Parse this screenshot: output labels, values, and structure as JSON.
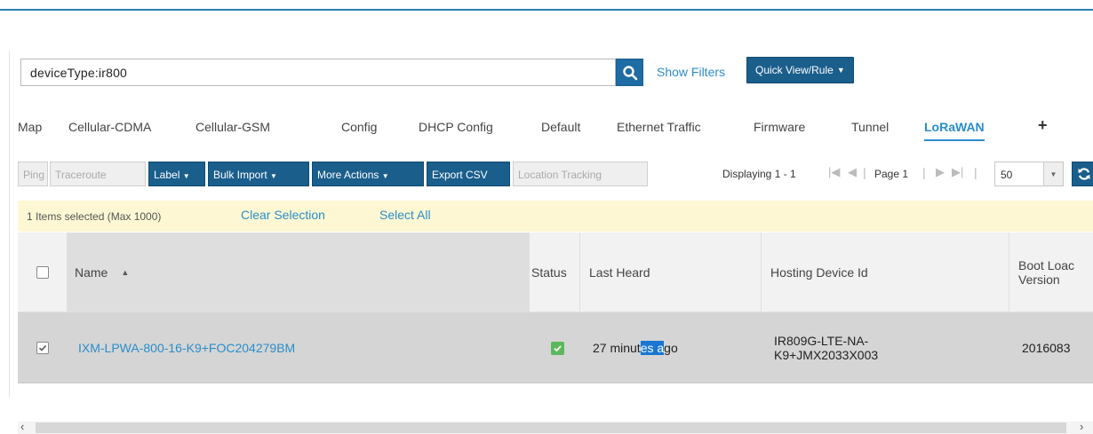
{
  "search": {
    "query": "deviceType:ir800",
    "show_filters": "Show Filters",
    "quick_view": "Quick View/Rule"
  },
  "tabs": [
    {
      "label": "Map"
    },
    {
      "label": "Cellular-CDMA"
    },
    {
      "label": "Cellular-GSM"
    },
    {
      "label": "Config"
    },
    {
      "label": "DHCP Config"
    },
    {
      "label": "Default"
    },
    {
      "label": "Ethernet Traffic"
    },
    {
      "label": "Firmware"
    },
    {
      "label": "Tunnel"
    },
    {
      "label": "LoRaWAN",
      "active": true
    }
  ],
  "toolbar": {
    "ping": "Ping",
    "traceroute": "Traceroute",
    "label": "Label",
    "bulk_import": "Bulk Import",
    "more_actions": "More Actions",
    "export_csv": "Export CSV",
    "location_tracking": "Location Tracking",
    "displaying": "Displaying 1 - 1",
    "page": "Page 1",
    "page_size": "50"
  },
  "selection": {
    "count_text": "1 Items selected (Max 1000)",
    "clear": "Clear Selection",
    "select_all": "Select All"
  },
  "grid": {
    "columns": {
      "name": "Name",
      "status": "Status",
      "last_heard": "Last Heard",
      "hosting": "Hosting Device Id",
      "boot_loader": "Boot Loac",
      "boot_loader_2": "Version"
    },
    "rows": [
      {
        "name": "IXM-LPWA-800-16-K9+FOC204279BM",
        "last_heard_pre": "27 minut",
        "last_heard_sel": "es a",
        "last_heard_post": "go",
        "hosting_1": "IR809G-LTE-NA-",
        "hosting_2": "K9+JMX2033X003",
        "boot_loader": "2016083"
      }
    ]
  },
  "colors": {
    "primary": "#1a5e8c",
    "link": "#2b8dca",
    "status_ok": "#5cb85c",
    "selection_bar": "#fdf8d3"
  }
}
